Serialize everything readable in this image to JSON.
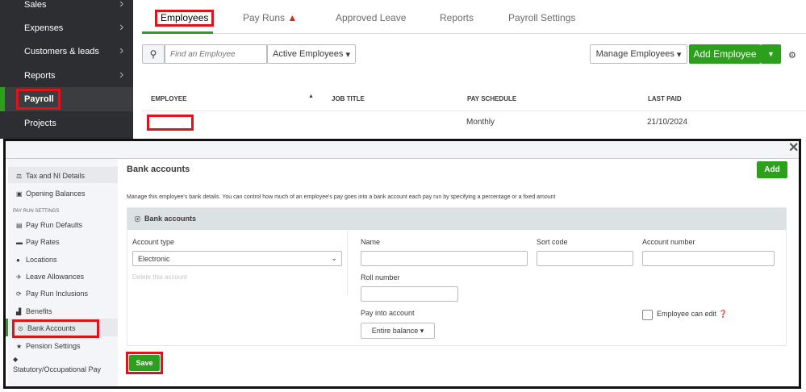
{
  "left_nav": {
    "items": [
      {
        "label": "Sales"
      },
      {
        "label": "Expenses"
      },
      {
        "label": "Customers & leads"
      },
      {
        "label": "Reports"
      },
      {
        "label": "Payroll",
        "active": true
      },
      {
        "label": "Projects"
      }
    ]
  },
  "tabs": [
    {
      "label": "Employees",
      "active": true
    },
    {
      "label": "Pay Runs",
      "warning": true
    },
    {
      "label": "Approved Leave"
    },
    {
      "label": "Reports"
    },
    {
      "label": "Payroll Settings"
    }
  ],
  "toolbar": {
    "search_placeholder": "Find an Employee",
    "filter": "Active Employees",
    "manage": "Manage Employees",
    "add": "Add Employee"
  },
  "table": {
    "columns": [
      "EMPLOYEE",
      "JOB TITLE",
      "PAY SCHEDULE",
      "LAST PAID"
    ],
    "rows": [
      {
        "employee": "",
        "job_title": "",
        "pay_schedule": "Monthly",
        "last_paid": "21/10/2024"
      }
    ]
  },
  "modal": {
    "sidebar": {
      "items": [
        "Tax and NI Details",
        "Opening Balances"
      ],
      "section": "PAY RUN SETTINGS",
      "section_items": [
        "Pay Run Defaults",
        "Pay Rates",
        "Locations",
        "Leave Allowances",
        "Pay Run Inclusions",
        "Benefits",
        "Bank Accounts",
        "Pension Settings",
        "Statutory/Occupational Pay"
      ]
    },
    "title": "Bank accounts",
    "add": "Add",
    "description": "Manage this employee's bank details. You can control how much of an employee's pay goes into a bank account each pay run by specifying a percentage or a fixed amount",
    "panel_title": "Bank accounts",
    "account_type_label": "Account type",
    "account_type_value": "Electronic",
    "delete": "Delete this account",
    "name_label": "Name",
    "sort_code_label": "Sort code",
    "account_number_label": "Account number",
    "roll_number_label": "Roll number",
    "pay_into_label": "Pay into account",
    "pay_into_value": "Entire balance",
    "employee_can_edit": "Employee can edit",
    "save": "Save"
  },
  "colors": {
    "accent": "#2ca01c",
    "highlight": "#e0131a",
    "nav_bg": "#2d2e31"
  }
}
